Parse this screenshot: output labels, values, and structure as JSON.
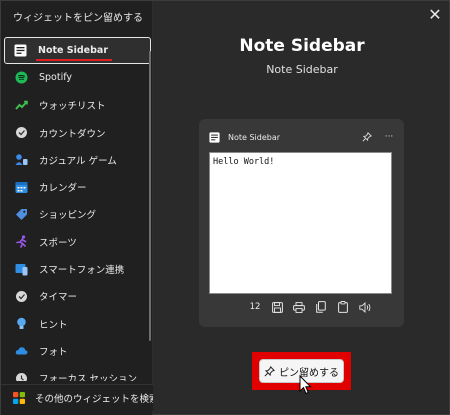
{
  "dialog": {
    "title": "ウィジェットをピン留めする",
    "close_glyph": "✕"
  },
  "widget_list": {
    "items": [
      {
        "label": "Note Sidebar",
        "icon": "note-icon",
        "selected": true
      },
      {
        "label": "Spotify",
        "icon": "spotify-icon",
        "color": "#1db954"
      },
      {
        "label": "ウォッチリスト",
        "icon": "watchlist-icon",
        "color": "#3fbf4f"
      },
      {
        "label": "カウントダウン",
        "icon": "countdown-icon"
      },
      {
        "label": "カジュアル ゲーム",
        "icon": "casual-games-icon",
        "color": "#3b8beb"
      },
      {
        "label": "カレンダー",
        "icon": "calendar-icon",
        "color": "#2f8de4"
      },
      {
        "label": "ショッピング",
        "icon": "shopping-tag-icon",
        "color": "#4f8fe0"
      },
      {
        "label": "スポーツ",
        "icon": "sports-runner-icon",
        "color": "#9a57e8"
      },
      {
        "label": "スマートフォン連携",
        "icon": "phone-link-icon",
        "color": "#2f8de4"
      },
      {
        "label": "タイマー",
        "icon": "timer-icon"
      },
      {
        "label": "ヒント",
        "icon": "tips-bulb-icon",
        "color": "#58a8f0"
      },
      {
        "label": "フォト",
        "icon": "photos-cloud-icon",
        "color": "#2f8de4"
      },
      {
        "label": "フォーカス セッション",
        "icon": "focus-session-icon"
      }
    ],
    "search_more_label": "その他のウィジェットを検索する"
  },
  "preview": {
    "title": "Note Sidebar",
    "subtitle": "Note Sidebar",
    "card": {
      "header_label": "Note Sidebar",
      "pin_glyph": "📌",
      "more_glyph": "···",
      "note_text": "Hello World!",
      "font_size": "12",
      "tools": [
        "save-icon",
        "print-icon",
        "copy-icon",
        "paste-icon",
        "speaker-icon"
      ]
    }
  },
  "pin_button": {
    "label": "ピン留めする"
  },
  "colors": {
    "highlight": "#e00000",
    "underline": "#e02020",
    "background": "#2a2a2a",
    "card": "#383838"
  }
}
